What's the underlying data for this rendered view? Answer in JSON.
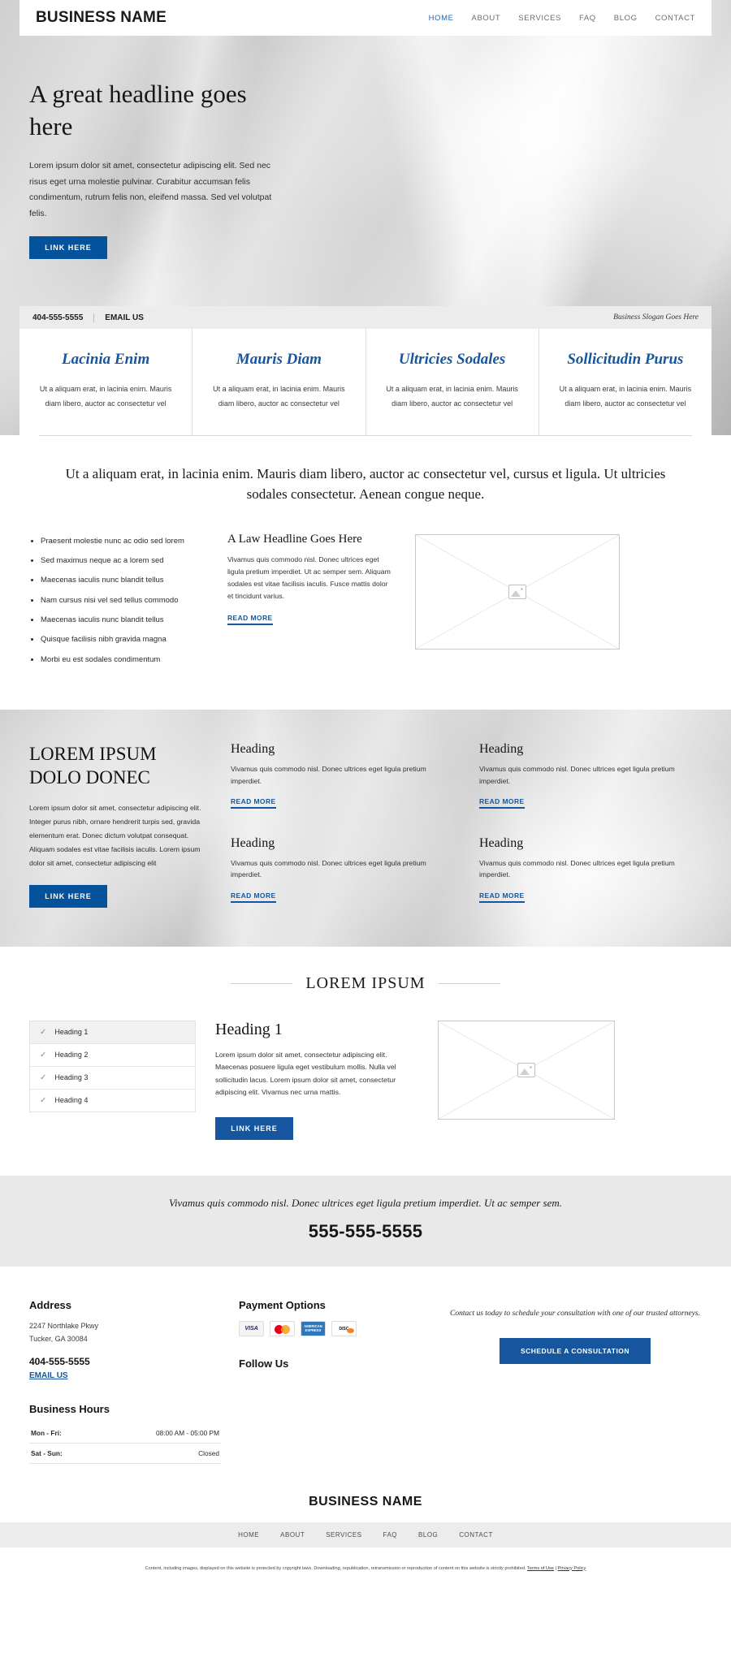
{
  "header": {
    "logo": "BUSINESS NAME",
    "nav": [
      {
        "label": "HOME",
        "active": true
      },
      {
        "label": "ABOUT",
        "active": false
      },
      {
        "label": "SERVICES",
        "active": false
      },
      {
        "label": "FAQ",
        "active": false
      },
      {
        "label": "BLOG",
        "active": false
      },
      {
        "label": "CONTACT",
        "active": false
      }
    ]
  },
  "hero": {
    "headline": "A great headline goes here",
    "body": "Lorem ipsum dolor sit amet, consectetur adipiscing elit. Sed nec risus eget urna molestie pulvinar. Curabitur accumsan felis condimentum, rutrum felis non, eleifend massa. Sed vel volutpat felis.",
    "cta": "LINK HERE"
  },
  "contact_bar": {
    "phone": "404-555-5555",
    "email_label": "EMAIL US",
    "slogan": "Business Slogan Goes Here"
  },
  "cards": [
    {
      "title": "Lacinia Enim",
      "body": "Ut a aliquam erat, in lacinia enim. Mauris diam libero, auctor ac consectetur vel"
    },
    {
      "title": "Mauris Diam",
      "body": "Ut a aliquam erat, in lacinia enim. Mauris diam libero, auctor ac consectetur vel"
    },
    {
      "title": "Ultricies Sodales",
      "body": "Ut a aliquam erat, in lacinia enim. Mauris diam libero, auctor ac consectetur vel"
    },
    {
      "title": "Sollicitudin Purus",
      "body": "Ut a aliquam erat, in lacinia enim. Mauris diam libero, auctor ac consectetur vel"
    }
  ],
  "intro": {
    "text": "Ut a aliquam erat, in lacinia enim. Mauris diam libero, auctor ac consectetur vel, cursus et ligula. Ut ultricies sodales consectetur. Aenean congue neque."
  },
  "bullets": [
    "Praesent molestie nunc ac odio sed lorem",
    "Sed maximus neque ac a lorem sed",
    "Maecenas iaculis nunc blandit tellus",
    "Nam cursus nisi vel sed tellus commodo",
    "Maecenas iaculis nunc blandit tellus",
    "Quisque facilisis nibh gravida magna",
    "Morbi eu est sodales condimentum"
  ],
  "law": {
    "heading": "A Law Headline Goes Here",
    "body": "Vivamus quis commodo nisl. Donec ultrices eget ligula pretium imperdiet. Ut ac semper sem. Aliquam sodales est vitae facilisis iaculis. Fusce mattis dolor et tincidunt varius.",
    "read_more": "READ MORE"
  },
  "band": {
    "heading": "LOREM IPSUM DOLO DONEC",
    "body": "Lorem ipsum dolor sit amet, consectetur adipiscing elit. Integer purus nibh, ornare hendrerit turpis sed, gravida elementum erat. Donec dictum volutpat consequat. Aliquam sodales est vitae facilisis iaculis.  Lorem ipsum dolor sit amet, consectetur adipiscing elit",
    "cta": "LINK HERE",
    "cells": [
      {
        "heading": "Heading",
        "body": "Vivamus quis commodo nisl. Donec ultrices eget ligula pretium imperdiet.",
        "read_more": "READ MORE"
      },
      {
        "heading": "Heading",
        "body": "Vivamus quis commodo nisl. Donec ultrices eget ligula pretium imperdiet.",
        "read_more": "READ MORE"
      },
      {
        "heading": "Heading",
        "body": "Vivamus quis commodo nisl. Donec ultrices eget ligula pretium imperdiet.",
        "read_more": "READ MORE"
      },
      {
        "heading": "Heading",
        "body": "Vivamus quis commodo nisl. Donec ultrices eget ligula pretium imperdiet.",
        "read_more": "READ MORE"
      }
    ]
  },
  "section3": {
    "title": "LOREM IPSUM",
    "accordion": [
      {
        "label": "Heading 1",
        "selected": true
      },
      {
        "label": "Heading 2",
        "selected": false
      },
      {
        "label": "Heading 3",
        "selected": false
      },
      {
        "label": "Heading 4",
        "selected": false
      }
    ],
    "heading": "Heading 1",
    "body": "Lorem ipsum dolor sit amet, consectetur adipiscing elit. Maecenas posuere ligula eget vestibulum mollis. Nulla vel sollicitudin lacus. Lorem ipsum dolor sit amet, consectetur adipiscing elit. Vivamus nec urna mattis.",
    "cta": "LINK HERE"
  },
  "quote": {
    "text": "Vivamus quis commodo nisl. Donec ultrices eget ligula pretium imperdiet. Ut ac semper sem.",
    "phone": "555-555-5555"
  },
  "footer": {
    "address_title": "Address",
    "address_line1": "2247 Northlake Pkwy",
    "address_line2": "Tucker, GA 30084",
    "phone": "404-555-5555",
    "email_label": "EMAIL US",
    "hours_title": "Business Hours",
    "hours": [
      {
        "day": "Mon - Fri:",
        "time": "08:00 AM - 05:00 PM"
      },
      {
        "day": "Sat - Sun:",
        "time": "Closed"
      }
    ],
    "payment_title": "Payment Options",
    "payment_methods": [
      "VISA",
      "MasterCard",
      "AMERICAN EXPRESS",
      "DISCOVER"
    ],
    "follow_title": "Follow Us",
    "consult_note": "Contact us today to schedule your consultation with one of our trusted attorneys.",
    "consult_cta": "SCHEDULE A CONSULTATION"
  },
  "bottom": {
    "business_name": "BUSINESS NAME",
    "nav": [
      "HOME",
      "ABOUT",
      "SERVICES",
      "FAQ",
      "BLOG",
      "CONTACT"
    ],
    "copyright": "Content, including images, displayed on this website is protected by copyright laws. Downloading, republication, retransmission or reproduction of content on this website is strictly prohibited.",
    "terms": "Terms of Use",
    "privacy": "Privacy Policy"
  },
  "colors": {
    "accent": "#15569e",
    "hero_button": "#05529c"
  }
}
